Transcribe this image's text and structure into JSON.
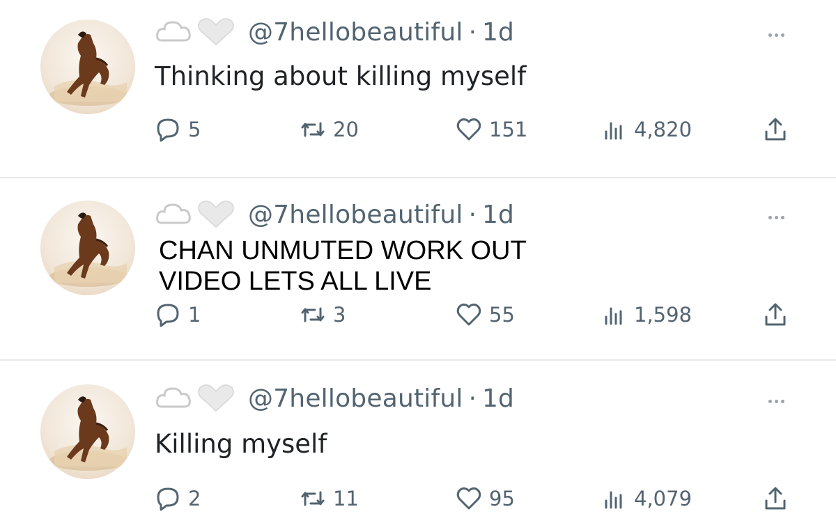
{
  "tweets": [
    {
      "handle": "@7hellobeautiful",
      "separator": "·",
      "time": "1d",
      "text": "Thinking about killing myself",
      "replies": "5",
      "retweets": "20",
      "likes": "151",
      "views": "4,820"
    },
    {
      "handle": "@7hellobeautiful",
      "separator": "·",
      "time": "1d",
      "overlay_text": "CHAN UNMUTED WORK OUT VIDEO LETS ALL LIVE",
      "replies": "1",
      "retweets": "3",
      "likes": "55",
      "views": "1,598"
    },
    {
      "handle": "@7hellobeautiful",
      "separator": "·",
      "time": "1d",
      "text": "Killing myself",
      "replies": "2",
      "retweets": "11",
      "likes": "95",
      "views": "4,079"
    }
  ],
  "icons": {
    "avatar": "horse-avatar",
    "reply": "reply-icon",
    "retweet": "retweet-icon",
    "like": "heart-icon",
    "views": "views-icon",
    "share": "share-icon",
    "more": "more-icon"
  },
  "colors": {
    "muted": "#536471",
    "divider": "#e6e6e6",
    "text": "#202326"
  }
}
